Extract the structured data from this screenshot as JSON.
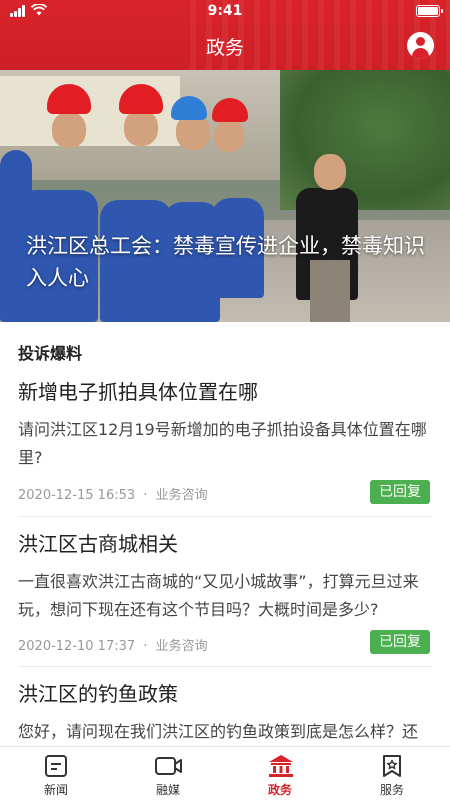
{
  "status_bar": {
    "time": "9:41"
  },
  "header": {
    "title": "政务"
  },
  "banner": {
    "caption": "洪江区总工会：禁毒宣传进企业，禁毒知识入人心",
    "slide_count": 5,
    "active_slide": 1
  },
  "section": {
    "title": "投诉爆料"
  },
  "items": [
    {
      "title": "新增电子抓拍具体位置在哪",
      "body": "请问洪江区12月19号新增加的电子抓拍设备具体位置在哪里?",
      "date": "2020-12-15 16:53",
      "separator": "·",
      "category": "业务咨询",
      "status": "已回复"
    },
    {
      "title": "洪江区古商城相关",
      "body": "一直很喜欢洪江古商城的“又见小城故事”，打算元旦过来玩，想问下现在还有这个节目吗？大概时间是多少?",
      "date": "2020-12-10 17:37",
      "separator": "·",
      "category": "业务咨询",
      "status": "已回复"
    },
    {
      "title": "洪江区的钓鱼政策",
      "body": "您好，请问现在我们洪江区的钓鱼政策到底是怎么样？还"
    }
  ],
  "tabs": [
    {
      "label": "新闻",
      "icon": "news-icon"
    },
    {
      "label": "融媒",
      "icon": "media-icon"
    },
    {
      "label": "政务",
      "icon": "government-icon"
    },
    {
      "label": "服务",
      "icon": "service-icon"
    }
  ],
  "colors": {
    "brand": "#d8232a",
    "status_tag": "#4caf50",
    "meta_text": "#999999"
  }
}
